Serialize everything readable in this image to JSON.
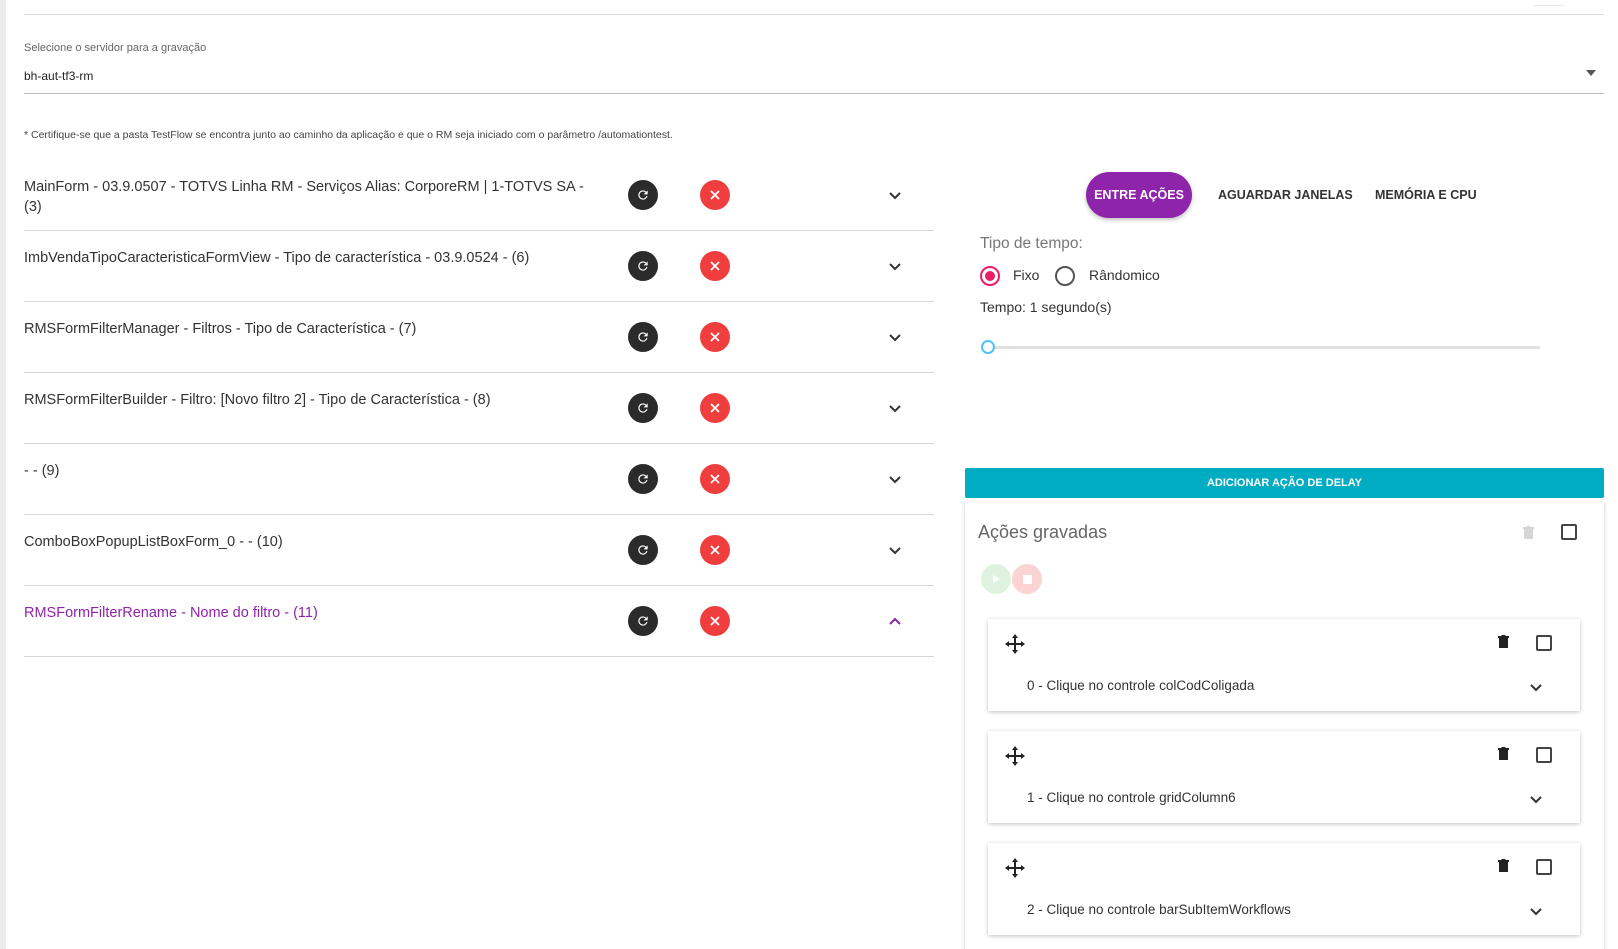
{
  "server": {
    "label": "Selecione o servidor para a gravação",
    "value": "bh-aut-tf3-rm"
  },
  "note": "* Certifique-se que a pasta TestFlow se encontra junto ao caminho da aplicação e que o RM seja iniciado com o parâmetro /automationtest.",
  "windows": [
    {
      "title": "MainForm - 03.9.0507 - TOTVS Linha RM - Serviços Alias: CorporeRM | 1-TOTVS SA - (3)",
      "expanded": false
    },
    {
      "title": "ImbVendaTipoCaracteristicaFormView - Tipo de característica - 03.9.0524 - (6)",
      "expanded": false
    },
    {
      "title": "RMSFormFilterManager - Filtros - Tipo de Característica - (7)",
      "expanded": false
    },
    {
      "title": "RMSFormFilterBuilder - Filtro: [Novo filtro 2] - Tipo de Característica - (8)",
      "expanded": false
    },
    {
      "title": "- - (9)",
      "expanded": false
    },
    {
      "title": "ComboBoxPopupListBoxForm_0 - - (10)",
      "expanded": false
    },
    {
      "title": "RMSFormFilterRename - Nome do filtro - (11)",
      "expanded": true
    }
  ],
  "tabs": [
    {
      "label": "ENTRE AÇÕES",
      "active": true
    },
    {
      "label": "AGUARDAR JANELAS",
      "active": false
    },
    {
      "label": "MEMÓRIA E CPU",
      "active": false
    }
  ],
  "timing": {
    "type_label": "Tipo de tempo:",
    "options": [
      "Fixo",
      "Rândomico"
    ],
    "selected": "Fixo",
    "tempo_label": "Tempo: 1 segundo(s)",
    "slider_value": 0
  },
  "add_delay_label": "ADICIONAR AÇÃO DE DELAY",
  "recorded": {
    "title": "Ações gravadas",
    "actions": [
      "0 - Clique no controle colCodColigada",
      "1 - Clique no controle gridColumn6",
      "2 - Clique no controle barSubItemWorkflows"
    ]
  },
  "colors": {
    "accent": "#8e24aa",
    "radio": "#e91e63",
    "teal": "#00acc1",
    "danger": "#f03e3e"
  }
}
